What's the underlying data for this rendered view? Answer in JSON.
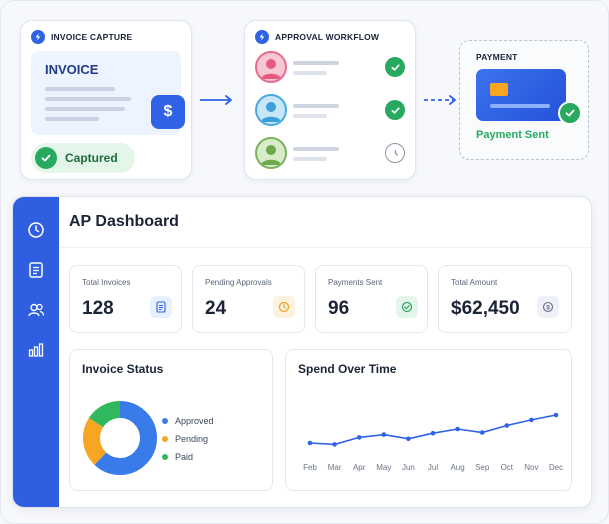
{
  "colors": {
    "primary": "#2f62e6",
    "success": "#27a960",
    "pending": "#f6a623",
    "sidebar": "#2f5fe0"
  },
  "capture": {
    "title": "INVOICE CAPTURE",
    "doc_title": "INVOICE",
    "badge": "Captured",
    "icon": "dollar-icon",
    "dollar": "$"
  },
  "workflow": {
    "title": "APPROVAL WORKFLOW",
    "approvers": [
      {
        "avatar": "approver-pink",
        "status": "approved"
      },
      {
        "avatar": "approver-blue",
        "status": "approved"
      },
      {
        "avatar": "approver-green",
        "status": "pending"
      }
    ]
  },
  "payment": {
    "title": "PAYMENT",
    "status": "Payment Sent"
  },
  "dashboard": {
    "title": "AP Dashboard",
    "sidebar_icons": [
      "clock-icon",
      "document-icon",
      "users-icon",
      "bar-chart-icon"
    ],
    "stats": [
      {
        "label": "Total Invoices",
        "value": "128",
        "icon": "document-icon"
      },
      {
        "label": "Pending Approvals",
        "value": "24",
        "icon": "clock-icon"
      },
      {
        "label": "Payments Sent",
        "value": "96",
        "icon": "check-icon"
      },
      {
        "label": "Total Amount",
        "value": "$62,450",
        "icon": "dollar-icon"
      }
    ]
  },
  "chart_data": [
    {
      "type": "pie",
      "title": "Invoice Status",
      "categories": [
        "Approved",
        "Pending",
        "Paid"
      ],
      "values": [
        62,
        22,
        16
      ],
      "colors": [
        "#3a7bea",
        "#f6a623",
        "#2fb85e"
      ],
      "legend": "right"
    },
    {
      "type": "line",
      "title": "Spend Over Time",
      "x": [
        "Feb",
        "Mar",
        "Apr",
        "May",
        "Jun",
        "Jul",
        "Aug",
        "Sep",
        "Oct",
        "Nov",
        "Dec"
      ],
      "series": [
        {
          "values": [
            2.0,
            1.6,
            3.6,
            4.4,
            3.2,
            4.8,
            6.0,
            5.0,
            7.0,
            8.6,
            10.0
          ]
        }
      ],
      "ylim": [
        0,
        12
      ],
      "grid": false,
      "color": "#2f62e6"
    }
  ]
}
